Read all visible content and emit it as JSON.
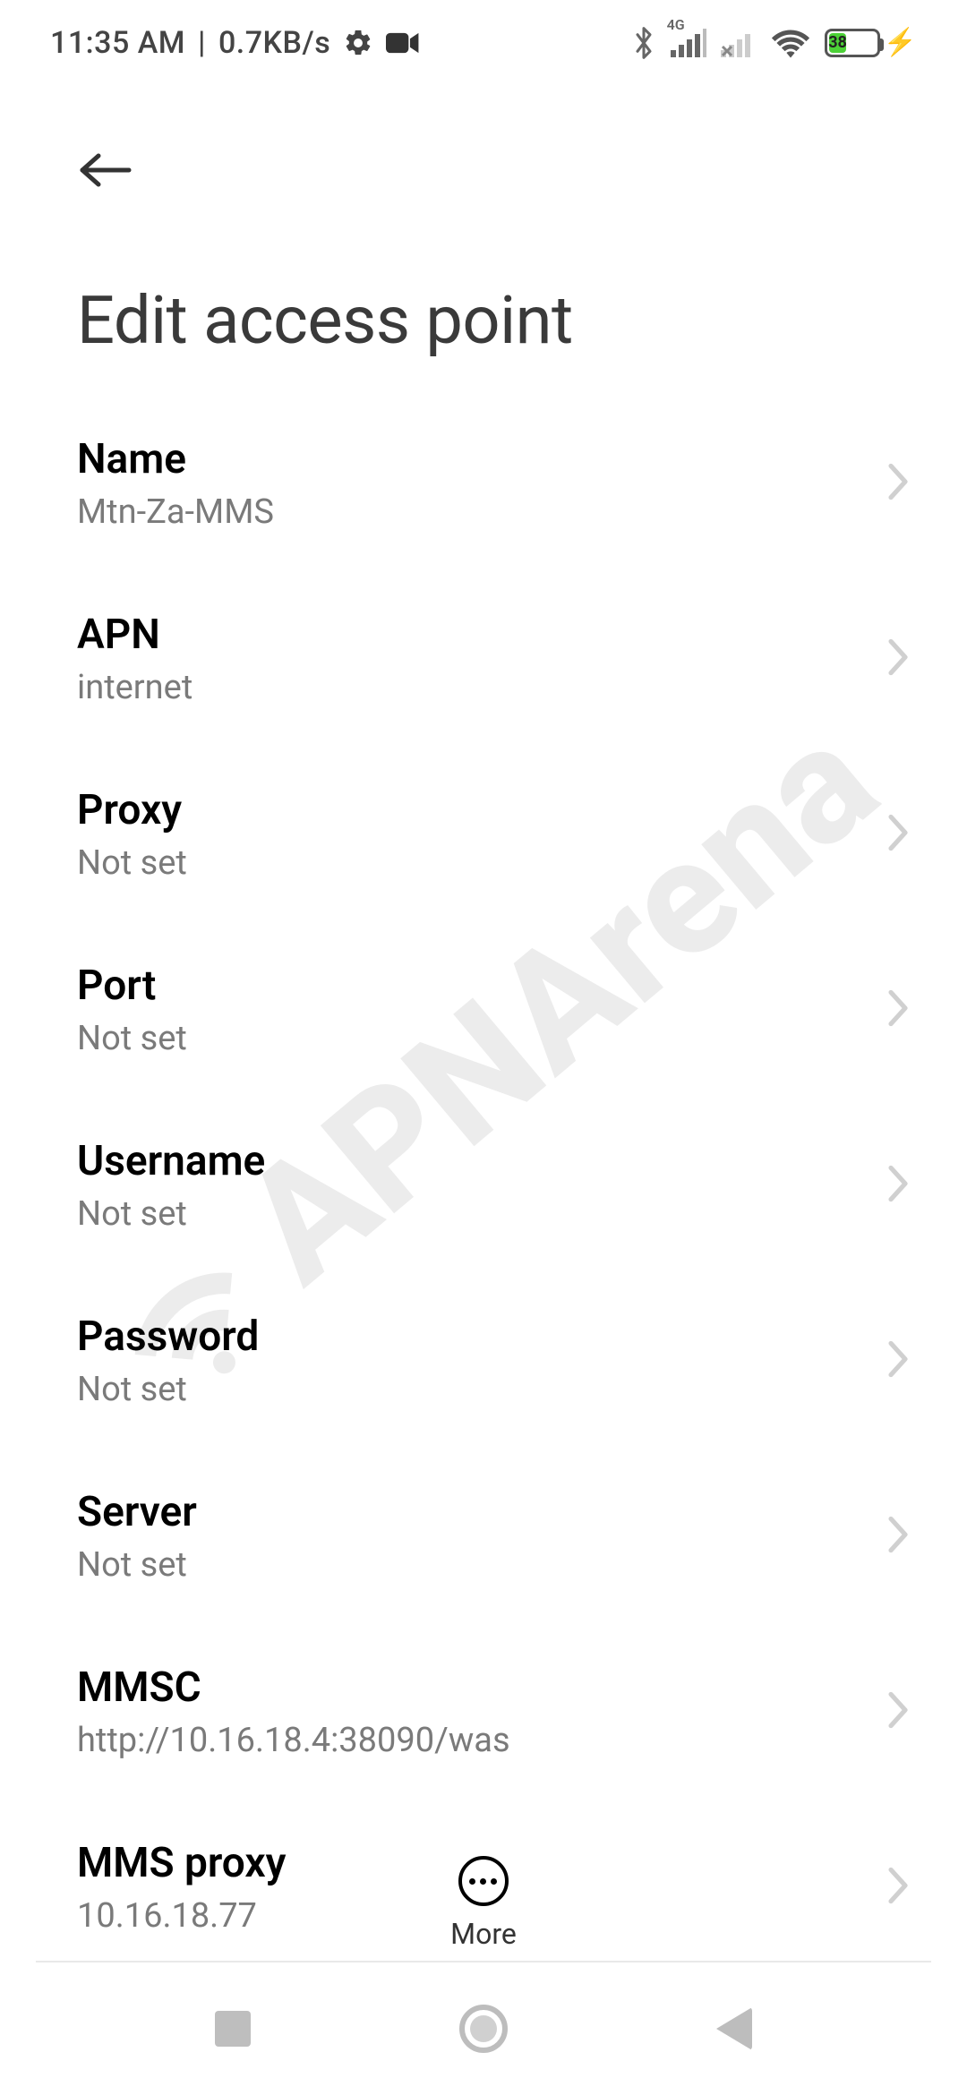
{
  "status": {
    "time": "11:35 AM",
    "sep": "|",
    "net_speed": "0.7KB/s",
    "network_badge": "4G",
    "battery_pct": "38"
  },
  "header": {
    "title": "Edit access point"
  },
  "settings": [
    {
      "key": "name",
      "title": "Name",
      "value": "Mtn-Za-MMS"
    },
    {
      "key": "apn",
      "title": "APN",
      "value": "internet"
    },
    {
      "key": "proxy",
      "title": "Proxy",
      "value": "Not set"
    },
    {
      "key": "port",
      "title": "Port",
      "value": "Not set"
    },
    {
      "key": "username",
      "title": "Username",
      "value": "Not set"
    },
    {
      "key": "password",
      "title": "Password",
      "value": "Not set"
    },
    {
      "key": "server",
      "title": "Server",
      "value": "Not set"
    },
    {
      "key": "mmsc",
      "title": "MMSC",
      "value": "http://10.16.18.4:38090/was"
    },
    {
      "key": "mms_proxy",
      "title": "MMS proxy",
      "value": "10.16.18.77"
    }
  ],
  "footer": {
    "more_label": "More"
  },
  "watermark": {
    "text": "APNArena"
  }
}
